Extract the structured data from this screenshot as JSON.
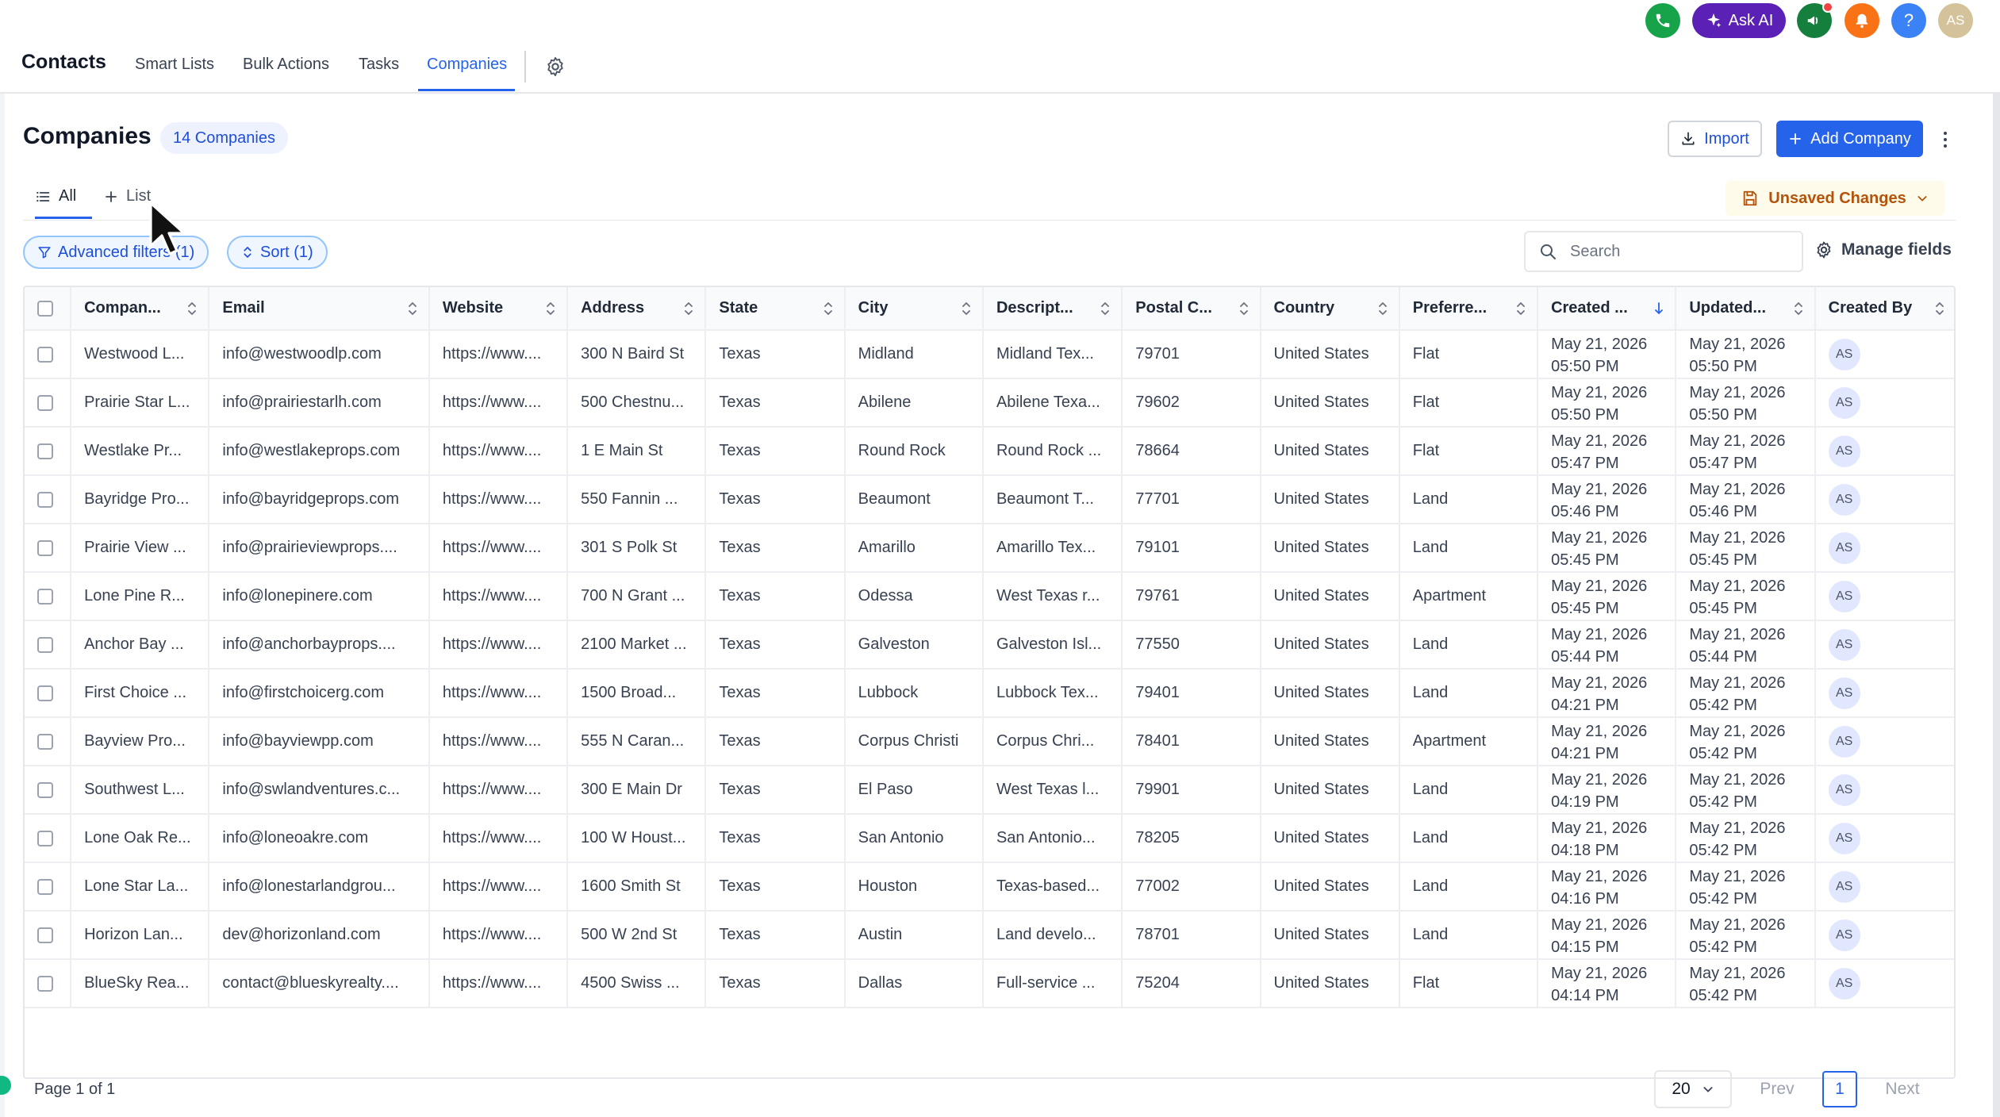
{
  "nav": {
    "app_title": "Contacts",
    "tabs": [
      "Smart Lists",
      "Bulk Actions",
      "Tasks",
      "Companies"
    ],
    "active_tab": "Companies",
    "ask_ai_label": "Ask AI",
    "help_label": "?",
    "user_initials": "AS",
    "colors": {
      "phone": "#16a34a",
      "ask_ai": "#5b21b6",
      "megaphone": "#16a34a",
      "bell": "#f97316",
      "help": "#3b82f6"
    }
  },
  "header": {
    "title": "Companies",
    "count_badge": "14 Companies",
    "import_label": "Import",
    "add_label": "Add Company"
  },
  "views": {
    "all_label": "All",
    "add_list_label": "List",
    "unsaved_label": "Unsaved Changes"
  },
  "filters": {
    "advanced_label": "Advanced filters (1)",
    "sort_label": "Sort (1)",
    "search_placeholder": "Search",
    "manage_fields_label": "Manage fields"
  },
  "table": {
    "columns": [
      "Compan...",
      "Email",
      "Website",
      "Address",
      "State",
      "City",
      "Descript...",
      "Postal C...",
      "Country",
      "Preferre...",
      "Created ...",
      "Updated...",
      "Created By"
    ],
    "rows": [
      {
        "company": "Westwood L...",
        "email": "info@westwoodlp.com",
        "website": "https://www....",
        "address": "300 N Baird St",
        "state": "Texas",
        "city": "Midland",
        "description": "Midland Tex...",
        "postal": "79701",
        "country": "United States",
        "preferred": "Flat",
        "created_date": "May 21, 2026",
        "created_time": "05:50 PM",
        "updated_date": "May 21, 2026",
        "updated_time": "05:50 PM",
        "created_by": "AS"
      },
      {
        "company": "Prairie Star L...",
        "email": "info@prairiestarlh.com",
        "website": "https://www....",
        "address": "500 Chestnu...",
        "state": "Texas",
        "city": "Abilene",
        "description": "Abilene Texa...",
        "postal": "79602",
        "country": "United States",
        "preferred": "Flat",
        "created_date": "May 21, 2026",
        "created_time": "05:50 PM",
        "updated_date": "May 21, 2026",
        "updated_time": "05:50 PM",
        "created_by": "AS"
      },
      {
        "company": "Westlake Pr...",
        "email": "info@westlakeprops.com",
        "website": "https://www....",
        "address": "1 E Main St",
        "state": "Texas",
        "city": "Round Rock",
        "description": "Round Rock ...",
        "postal": "78664",
        "country": "United States",
        "preferred": "Flat",
        "created_date": "May 21, 2026",
        "created_time": "05:47 PM",
        "updated_date": "May 21, 2026",
        "updated_time": "05:47 PM",
        "created_by": "AS"
      },
      {
        "company": "Bayridge Pro...",
        "email": "info@bayridgeprops.com",
        "website": "https://www....",
        "address": "550 Fannin ...",
        "state": "Texas",
        "city": "Beaumont",
        "description": "Beaumont T...",
        "postal": "77701",
        "country": "United States",
        "preferred": "Land",
        "created_date": "May 21, 2026",
        "created_time": "05:46 PM",
        "updated_date": "May 21, 2026",
        "updated_time": "05:46 PM",
        "created_by": "AS"
      },
      {
        "company": "Prairie View ...",
        "email": "info@prairieviewprops....",
        "website": "https://www....",
        "address": "301 S Polk St",
        "state": "Texas",
        "city": "Amarillo",
        "description": "Amarillo Tex...",
        "postal": "79101",
        "country": "United States",
        "preferred": "Land",
        "created_date": "May 21, 2026",
        "created_time": "05:45 PM",
        "updated_date": "May 21, 2026",
        "updated_time": "05:45 PM",
        "created_by": "AS"
      },
      {
        "company": "Lone Pine R...",
        "email": "info@lonepinere.com",
        "website": "https://www....",
        "address": "700 N Grant ...",
        "state": "Texas",
        "city": "Odessa",
        "description": "West Texas r...",
        "postal": "79761",
        "country": "United States",
        "preferred": "Apartment",
        "created_date": "May 21, 2026",
        "created_time": "05:45 PM",
        "updated_date": "May 21, 2026",
        "updated_time": "05:45 PM",
        "created_by": "AS"
      },
      {
        "company": "Anchor Bay ...",
        "email": "info@anchorbayprops....",
        "website": "https://www....",
        "address": "2100 Market ...",
        "state": "Texas",
        "city": "Galveston",
        "description": "Galveston Isl...",
        "postal": "77550",
        "country": "United States",
        "preferred": "Land",
        "created_date": "May 21, 2026",
        "created_time": "05:44 PM",
        "updated_date": "May 21, 2026",
        "updated_time": "05:44 PM",
        "created_by": "AS"
      },
      {
        "company": "First Choice ...",
        "email": "info@firstchoicerg.com",
        "website": "https://www....",
        "address": "1500 Broad...",
        "state": "Texas",
        "city": "Lubbock",
        "description": "Lubbock Tex...",
        "postal": "79401",
        "country": "United States",
        "preferred": "Land",
        "created_date": "May 21, 2026",
        "created_time": "04:21 PM",
        "updated_date": "May 21, 2026",
        "updated_time": "05:42 PM",
        "created_by": "AS"
      },
      {
        "company": "Bayview Pro...",
        "email": "info@bayviewpp.com",
        "website": "https://www....",
        "address": "555 N Caran...",
        "state": "Texas",
        "city": "Corpus Christi",
        "description": "Corpus Chri...",
        "postal": "78401",
        "country": "United States",
        "preferred": "Apartment",
        "created_date": "May 21, 2026",
        "created_time": "04:21 PM",
        "updated_date": "May 21, 2026",
        "updated_time": "05:42 PM",
        "created_by": "AS"
      },
      {
        "company": "Southwest L...",
        "email": "info@swlandventures.c...",
        "website": "https://www....",
        "address": "300 E Main Dr",
        "state": "Texas",
        "city": "El Paso",
        "description": "West Texas l...",
        "postal": "79901",
        "country": "United States",
        "preferred": "Land",
        "created_date": "May 21, 2026",
        "created_time": "04:19 PM",
        "updated_date": "May 21, 2026",
        "updated_time": "05:42 PM",
        "created_by": "AS"
      },
      {
        "company": "Lone Oak Re...",
        "email": "info@loneoakre.com",
        "website": "https://www....",
        "address": "100 W Houst...",
        "state": "Texas",
        "city": "San Antonio",
        "description": "San Antonio...",
        "postal": "78205",
        "country": "United States",
        "preferred": "Land",
        "created_date": "May 21, 2026",
        "created_time": "04:18 PM",
        "updated_date": "May 21, 2026",
        "updated_time": "05:42 PM",
        "created_by": "AS"
      },
      {
        "company": "Lone Star La...",
        "email": "info@lonestarlandgrou...",
        "website": "https://www....",
        "address": "1600 Smith St",
        "state": "Texas",
        "city": "Houston",
        "description": "Texas-based...",
        "postal": "77002",
        "country": "United States",
        "preferred": "Land",
        "created_date": "May 21, 2026",
        "created_time": "04:16 PM",
        "updated_date": "May 21, 2026",
        "updated_time": "05:42 PM",
        "created_by": "AS"
      },
      {
        "company": "Horizon Lan...",
        "email": "dev@horizonland.com",
        "website": "https://www....",
        "address": "500 W 2nd St",
        "state": "Texas",
        "city": "Austin",
        "description": "Land develo...",
        "postal": "78701",
        "country": "United States",
        "preferred": "Land",
        "created_date": "May 21, 2026",
        "created_time": "04:15 PM",
        "updated_date": "May 21, 2026",
        "updated_time": "05:42 PM",
        "created_by": "AS"
      },
      {
        "company": "BlueSky Rea...",
        "email": "contact@blueskyrealty....",
        "website": "https://www....",
        "address": "4500 Swiss ...",
        "state": "Texas",
        "city": "Dallas",
        "description": "Full-service ...",
        "postal": "75204",
        "country": "United States",
        "preferred": "Flat",
        "created_date": "May 21, 2026",
        "created_time": "04:14 PM",
        "updated_date": "May 21, 2026",
        "updated_time": "05:42 PM",
        "created_by": "AS"
      }
    ]
  },
  "pagination": {
    "page_label": "Page 1 of 1",
    "page_size": "20",
    "prev_label": "Prev",
    "current_page": "1",
    "next_label": "Next"
  }
}
